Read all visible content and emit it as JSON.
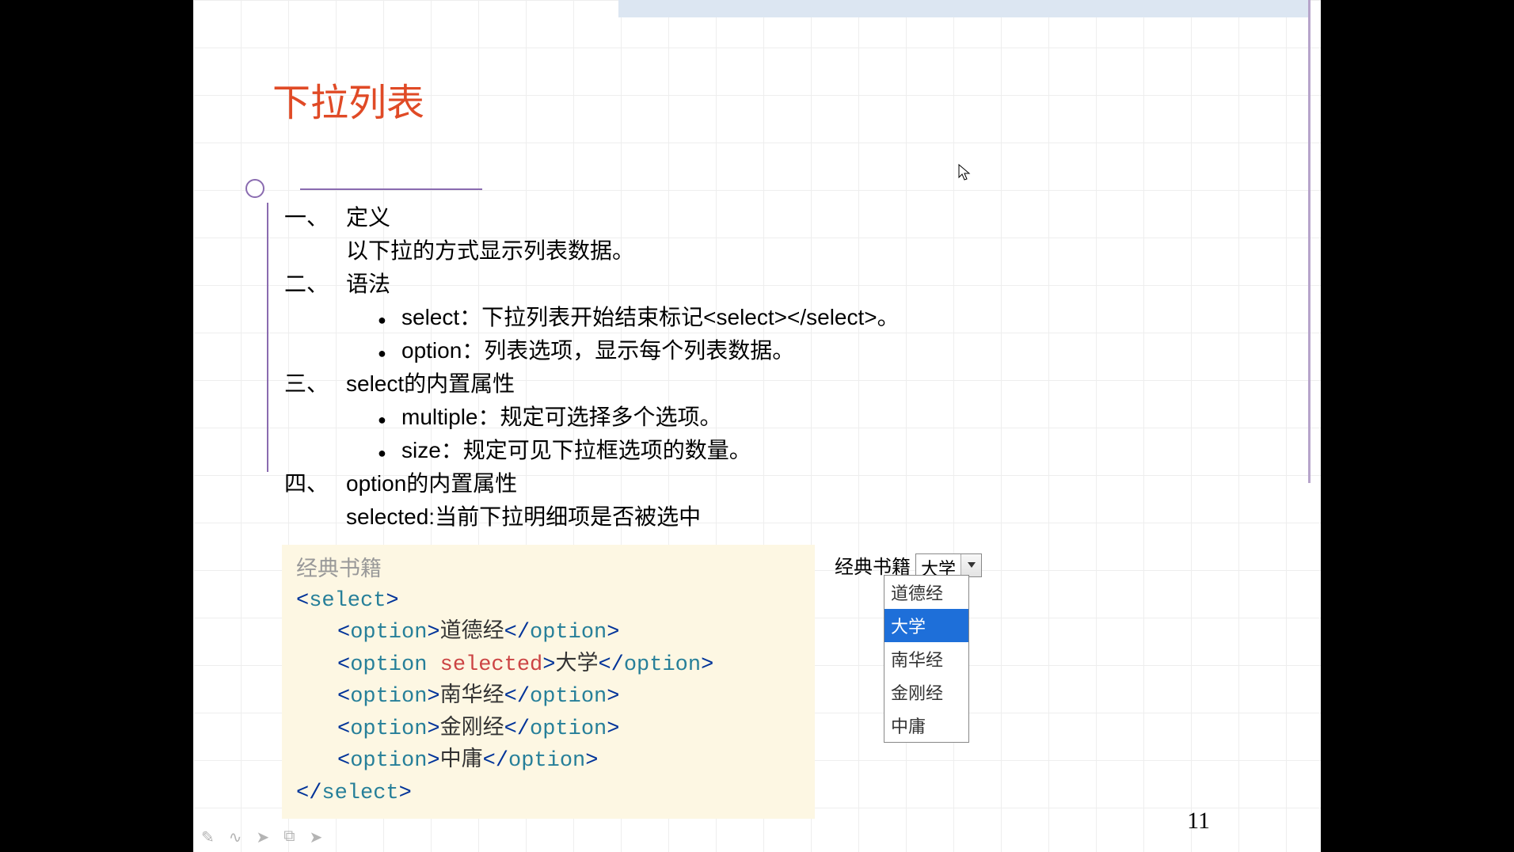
{
  "slide": {
    "title": "下拉列表",
    "page_number": "11"
  },
  "sections": {
    "s1": {
      "num": "一、",
      "label": "定义",
      "desc": "以下拉的方式显示列表数据。"
    },
    "s2": {
      "num": "二、",
      "label": "语法",
      "b1": "select：下拉列表开始结束标记<select></select>。",
      "b2": "option：列表选项，显示每个列表数据。"
    },
    "s3": {
      "num": "三、",
      "label": "select的内置属性",
      "b1": "multiple：规定可选择多个选项。",
      "b2": "size：规定可见下拉框选项的数量。"
    },
    "s4": {
      "num": "四、",
      "label": "option的内置属性",
      "desc": "selected:当前下拉明细项是否被选中"
    }
  },
  "code": {
    "label": "经典书籍",
    "open_br": "<",
    "close_br": ">",
    "end_br": "</",
    "tag_select": "select",
    "tag_option": "option",
    "attr_selected": " selected",
    "opt1": "道德经",
    "opt2": "大学",
    "opt3": "南华经",
    "opt4": "金刚经",
    "opt5": "中庸"
  },
  "demo": {
    "label": "经典书籍",
    "selected": "大学",
    "options": {
      "o1": "道德经",
      "o2": "大学",
      "o3": "南华经",
      "o4": "金刚经",
      "o5": "中庸"
    }
  }
}
